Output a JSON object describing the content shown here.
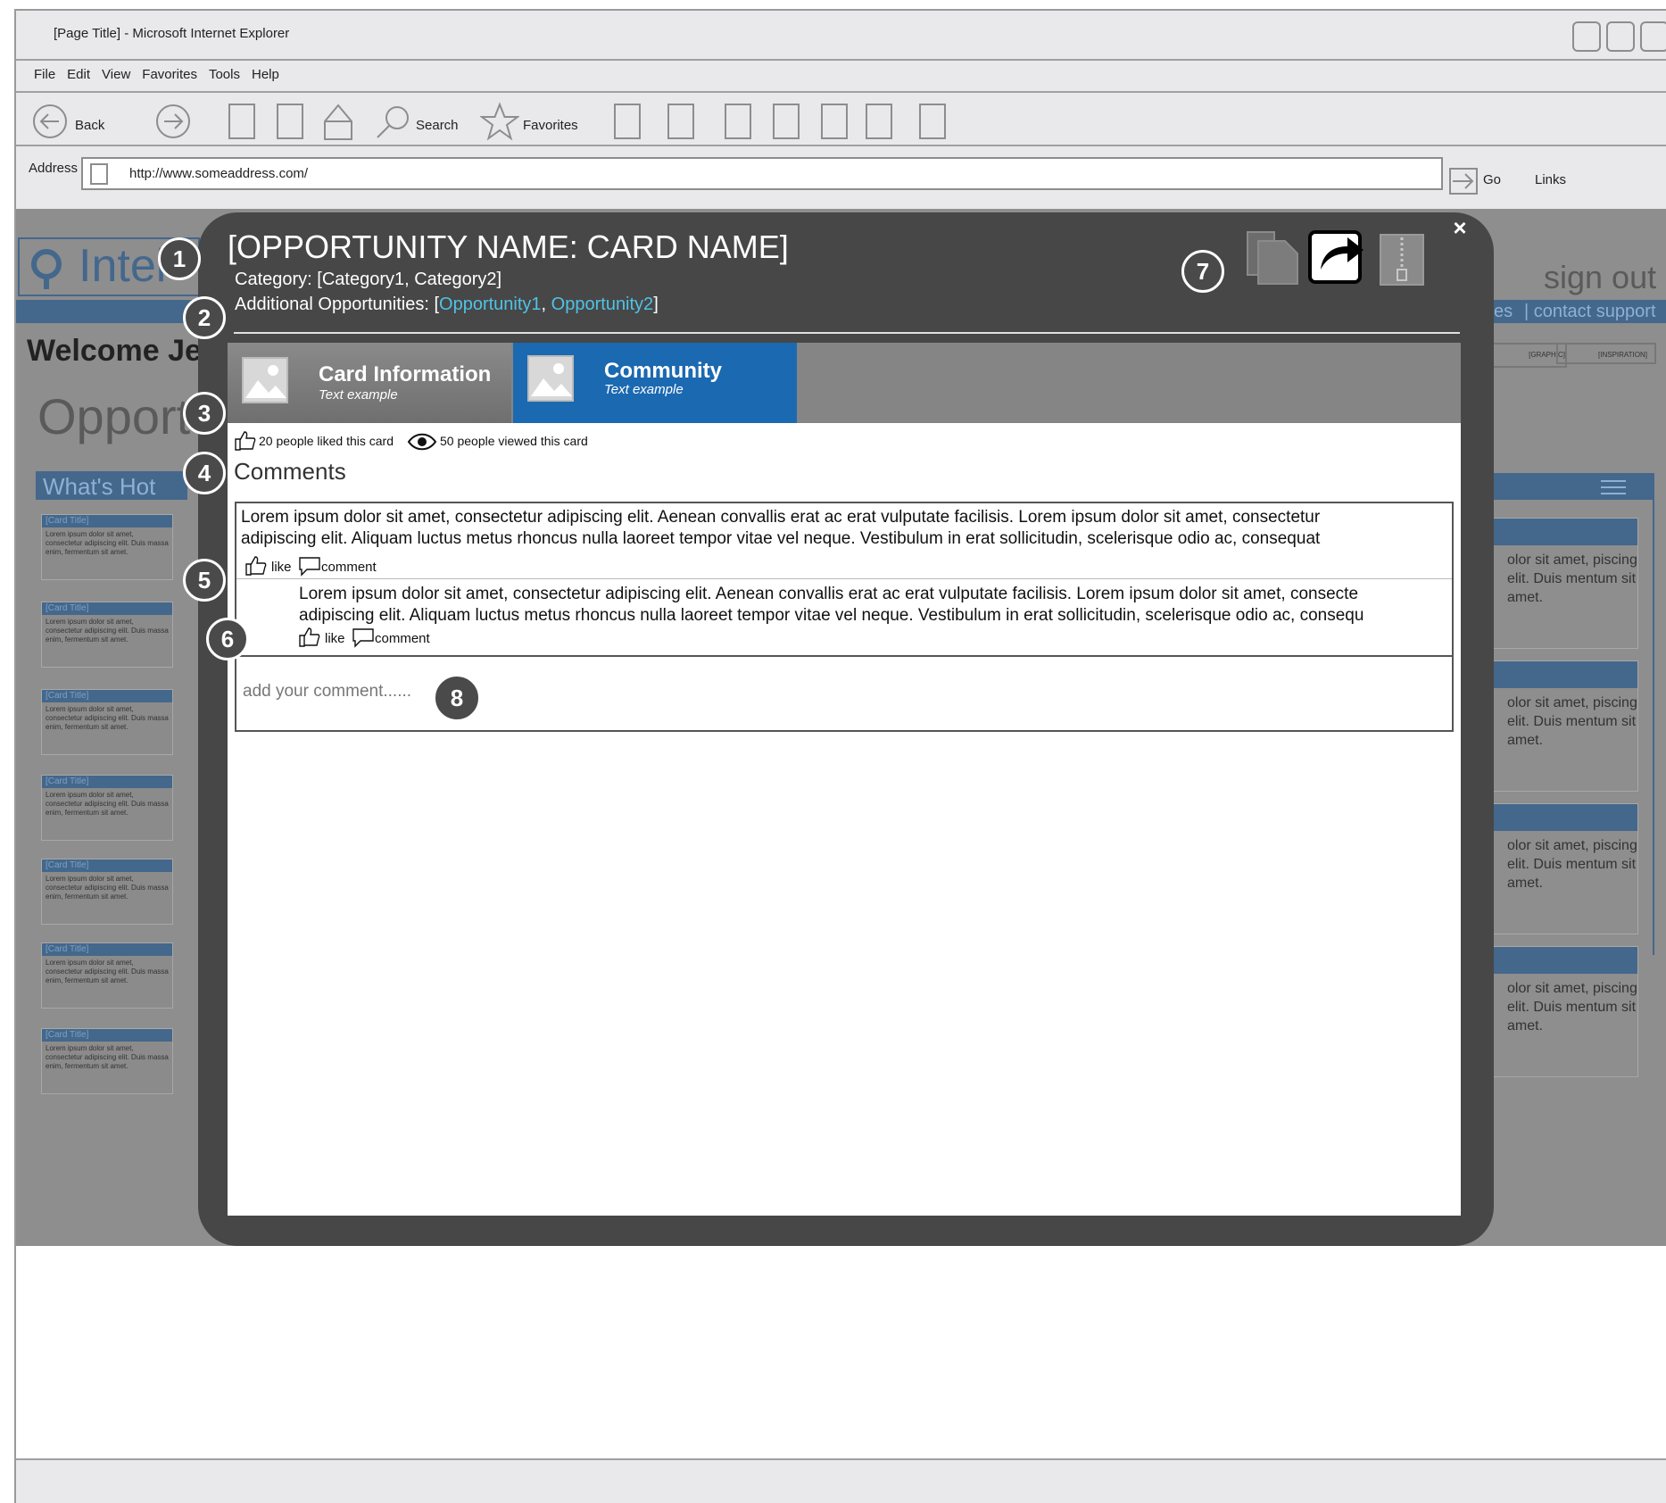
{
  "browser": {
    "window_title": "[Page Title] - Microsoft Internet Explorer",
    "menu": [
      "File",
      "Edit",
      "View",
      "Favorites",
      "Tools",
      "Help"
    ],
    "toolbar": {
      "back": "Back",
      "search": "Search",
      "favorites": "Favorites"
    },
    "address_label": "Address",
    "address_value": "http://www.someaddress.com/",
    "go": "Go",
    "links": "Links"
  },
  "background_page": {
    "logo_text": "Intel",
    "welcome": "Welcome Je",
    "heading": "Opport",
    "whats_hot": "What's Hot",
    "sign_out": "sign out",
    "nav_partial": "es",
    "contact_support": "| contact support",
    "tag1": "[GRAPHIC]",
    "tag2": "[INSPIRATION]",
    "mini_card_title": "[Card Title]",
    "mini_card_text": "Lorem ipsum dolor sit amet, consectetur adipiscing elit. Duis massa enim, fermentum sit amet.",
    "right_card_text": "olor sit amet, piscing elit. Duis mentum sit amet."
  },
  "modal": {
    "title": "[OPPORTUNITY NAME: CARD NAME]",
    "category": "Category: [Category1, Category2]",
    "additional_label": "Additional Opportunities: [",
    "additional_links": [
      "Opportunity1",
      "Opportunity2"
    ],
    "tabs": [
      {
        "title": "Card Information",
        "subtitle": "Text example",
        "active": false
      },
      {
        "title": "Community",
        "subtitle": "Text example",
        "active": true
      }
    ],
    "stats": {
      "likes": "20 people liked this card",
      "views": "50 people viewed this card"
    },
    "comments_heading": "Comments",
    "comments": [
      {
        "line1": "Lorem ipsum dolor sit amet, consectetur adipiscing elit. Aenean convallis erat ac erat vulputate facilisis. Lorem ipsum dolor sit amet, consectetur",
        "line2": "adipiscing elit. Aliquam luctus metus rhoncus nulla laoreet tempor vitae vel neque. Vestibulum in erat sollicitudin, scelerisque odio ac, consequat",
        "like": "like",
        "comment": "comment"
      },
      {
        "line1": "Lorem ipsum dolor sit amet, consectetur adipiscing elit. Aenean convallis erat ac erat vulputate facilisis. Lorem ipsum dolor sit amet, consecte",
        "line2": "adipiscing elit. Aliquam luctus metus rhoncus nulla laoreet tempor vitae vel neque. Vestibulum in erat sollicitudin, scelerisque odio ac, consequ",
        "like": "like",
        "comment": "comment"
      }
    ],
    "comment_placeholder": "add your comment......",
    "close": "×"
  },
  "badges": [
    "1",
    "2",
    "3",
    "4",
    "5",
    "6",
    "7",
    "8"
  ],
  "colors": {
    "modal_bg": "#474747",
    "active_tab": "#1b69b1",
    "link": "#4fc3e6",
    "brand": "#44678c"
  }
}
